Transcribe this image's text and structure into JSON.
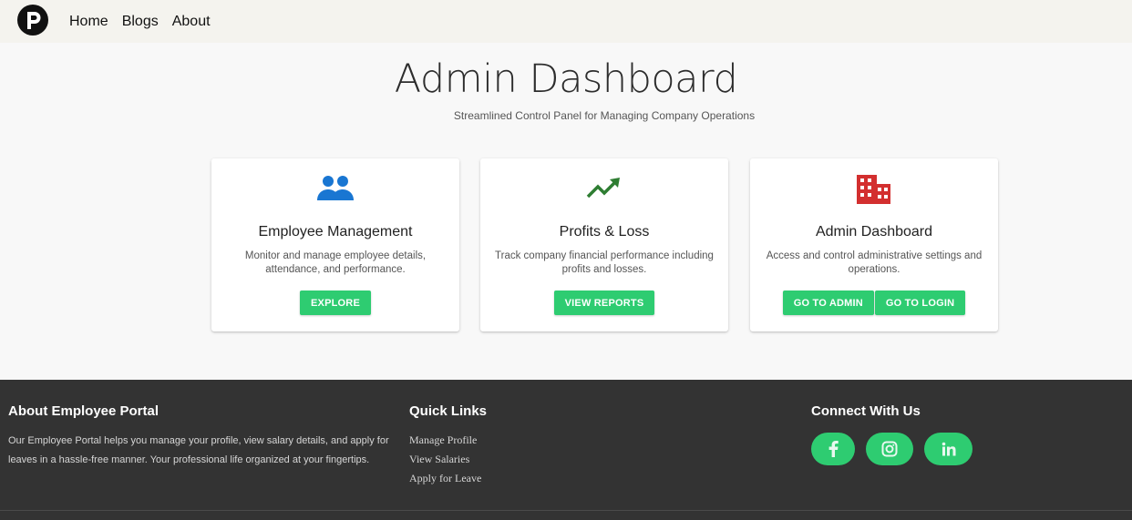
{
  "nav": {
    "logo_icon": "portal-logo-icon",
    "links": [
      "Home",
      "Blogs",
      "About"
    ]
  },
  "hero": {
    "title": "Admin Dashboard",
    "subtitle": "Streamlined Control Panel for Managing Company Operations"
  },
  "cards": [
    {
      "icon": "people-icon",
      "icon_color": "#1976d2",
      "title": "Employee Management",
      "description": "Monitor and manage employee details, attendance, and performance.",
      "buttons": [
        "EXPLORE"
      ]
    },
    {
      "icon": "trending-up-icon",
      "icon_color": "#2e7d32",
      "title": "Profits & Loss",
      "description": "Track company financial performance including profits and losses.",
      "buttons": [
        "VIEW REPORTS"
      ]
    },
    {
      "icon": "building-icon",
      "icon_color": "#d32f2f",
      "title": "Admin Dashboard",
      "description": "Access and control administrative settings and operations.",
      "buttons": [
        "GO TO ADMIN",
        "GO TO LOGIN"
      ]
    }
  ],
  "footer": {
    "about_heading": "About Employee Portal",
    "about_text": "Our Employee Portal helps you manage your profile, view salary details, and apply for leaves in a hassle-free manner. Your professional life organized at your fingertips.",
    "links_heading": "Quick Links",
    "links": [
      "Manage Profile",
      "View Salaries",
      "Apply for Leave"
    ],
    "connect_heading": "Connect With Us",
    "socials": [
      "facebook-icon",
      "instagram-icon",
      "linkedin-icon"
    ]
  },
  "colors": {
    "accent": "#2ecc71",
    "footer_bg": "#333333",
    "nav_bg": "#f4f3ee"
  }
}
